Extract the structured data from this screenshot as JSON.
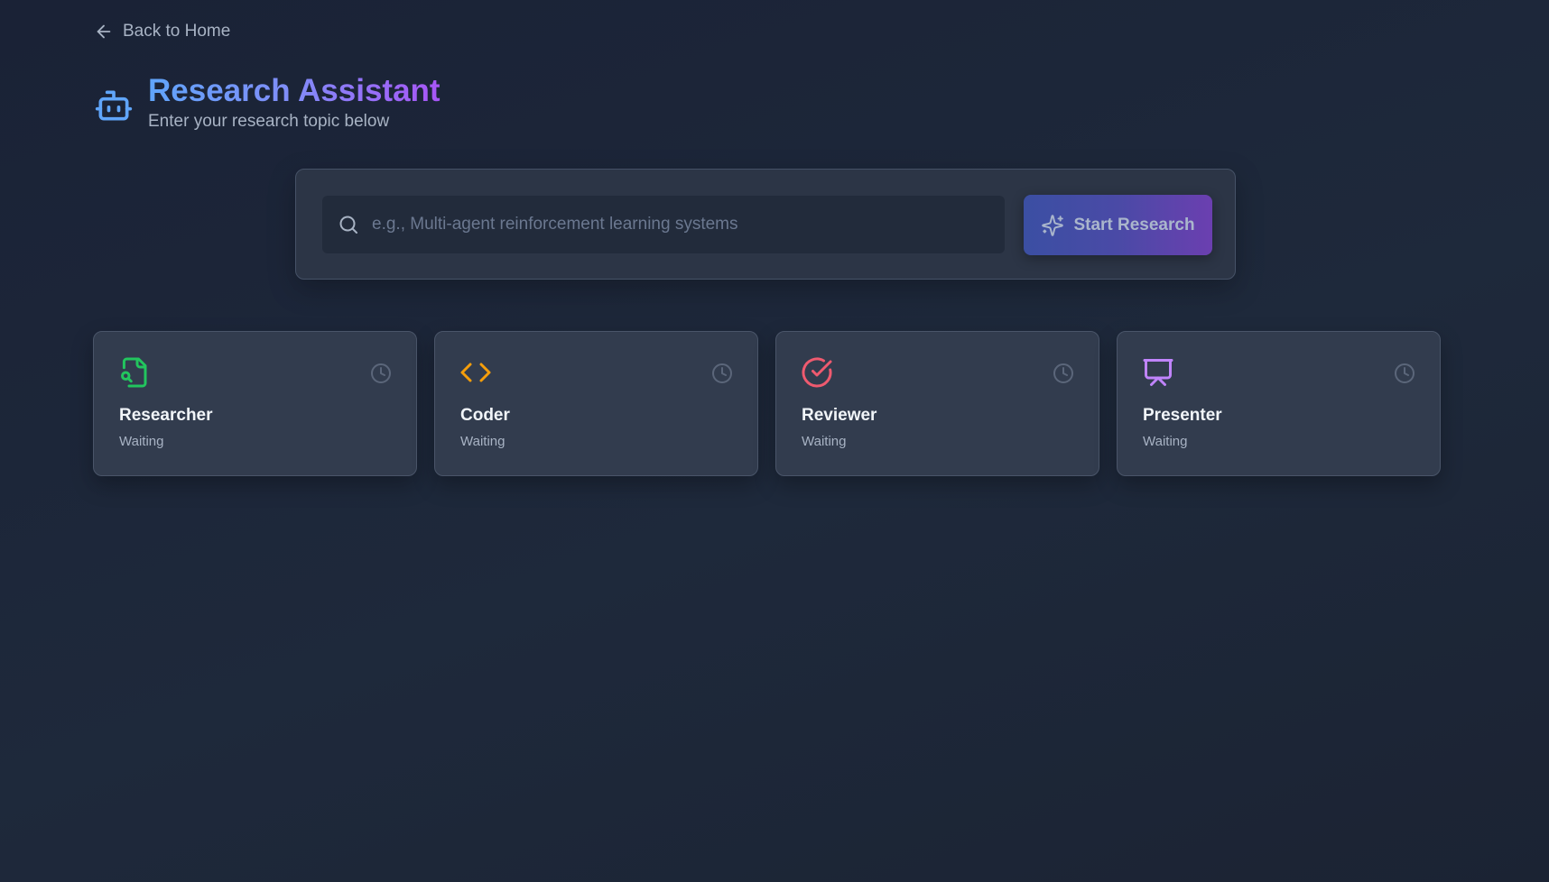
{
  "nav": {
    "back_label": "Back to Home"
  },
  "header": {
    "title": "Research Assistant",
    "subtitle": "Enter your research topic below",
    "icon": "robot-icon"
  },
  "search": {
    "placeholder": "e.g., Multi-agent reinforcement learning systems",
    "value": "",
    "button_label": "Start Research",
    "button_icon": "sparkles-icon"
  },
  "agents": [
    {
      "name": "Researcher",
      "status": "Waiting",
      "icon": "file-search-icon",
      "color": "#22c55e"
    },
    {
      "name": "Coder",
      "status": "Waiting",
      "icon": "code-icon",
      "color": "#f59e0b"
    },
    {
      "name": "Reviewer",
      "status": "Waiting",
      "icon": "check-circle-icon",
      "color": "#ef5a6f"
    },
    {
      "name": "Presenter",
      "status": "Waiting",
      "icon": "presentation-icon",
      "color": "#c084fc"
    }
  ],
  "colors": {
    "background": "#1e293b",
    "accent_blue": "#60a5fa",
    "accent_purple": "#a855f7",
    "status_icon": "#5b667a"
  }
}
